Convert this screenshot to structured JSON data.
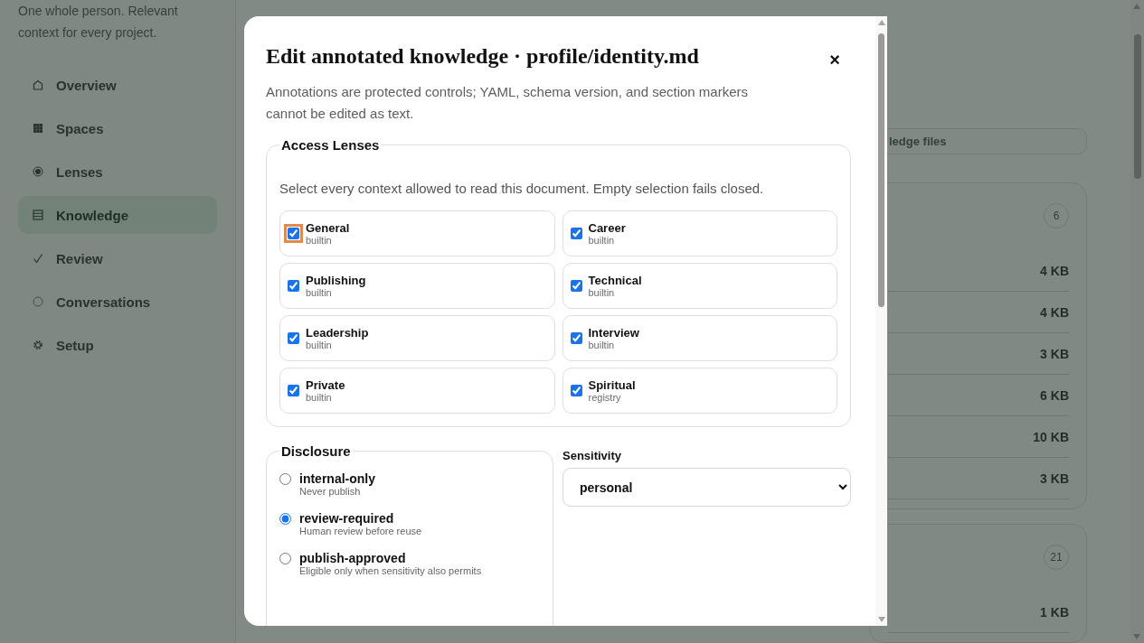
{
  "sidebar": {
    "tagline": "One whole person. Relevant context for every project.",
    "items": [
      {
        "label": "Overview",
        "kind": "home",
        "selected": false
      },
      {
        "label": "Spaces",
        "kind": "grid",
        "selected": false
      },
      {
        "label": "Lenses",
        "kind": "dot",
        "selected": false
      },
      {
        "label": "Knowledge",
        "kind": "list",
        "selected": true
      },
      {
        "label": "Review",
        "kind": "check",
        "selected": false
      },
      {
        "label": "Conversations",
        "kind": "circle",
        "selected": false
      },
      {
        "label": "Setup",
        "kind": "gear",
        "selected": false
      }
    ]
  },
  "background": {
    "filter_button": "ledge files",
    "groups": [
      {
        "count": "6",
        "rows": [
          "4 KB",
          "4 KB",
          "3 KB",
          "6 KB",
          "10 KB",
          "3 KB"
        ]
      },
      {
        "count": "21",
        "rows": [
          "1 KB"
        ]
      }
    ]
  },
  "dialog": {
    "title": "Edit annotated knowledge · profile/identity.md",
    "close": "×",
    "description": "Annotations are protected controls; YAML, schema version, and section markers cannot be edited as text.",
    "lenses": {
      "legend": "Access Lenses",
      "hint": "Select every context allowed to read this document. Empty selection fails closed.",
      "items": [
        {
          "label": "General",
          "source": "builtin",
          "checked": true,
          "focused": true
        },
        {
          "label": "Career",
          "source": "builtin",
          "checked": true,
          "focused": false
        },
        {
          "label": "Publishing",
          "source": "builtin",
          "checked": true,
          "focused": false
        },
        {
          "label": "Technical",
          "source": "builtin",
          "checked": true,
          "focused": false
        },
        {
          "label": "Leadership",
          "source": "builtin",
          "checked": true,
          "focused": false
        },
        {
          "label": "Interview",
          "source": "builtin",
          "checked": true,
          "focused": false
        },
        {
          "label": "Private",
          "source": "builtin",
          "checked": true,
          "focused": false
        },
        {
          "label": "Spiritual",
          "source": "registry",
          "checked": true,
          "focused": false
        }
      ]
    },
    "disclosure": {
      "legend": "Disclosure",
      "options": [
        {
          "label": "internal-only",
          "hint": "Never publish",
          "selected": false
        },
        {
          "label": "review-required",
          "hint": "Human review before reuse",
          "selected": true
        },
        {
          "label": "publish-approved",
          "hint": "Eligible only when sensitivity also permits",
          "selected": false
        }
      ]
    },
    "sensitivity": {
      "label": "Sensitivity",
      "value": "personal"
    }
  }
}
